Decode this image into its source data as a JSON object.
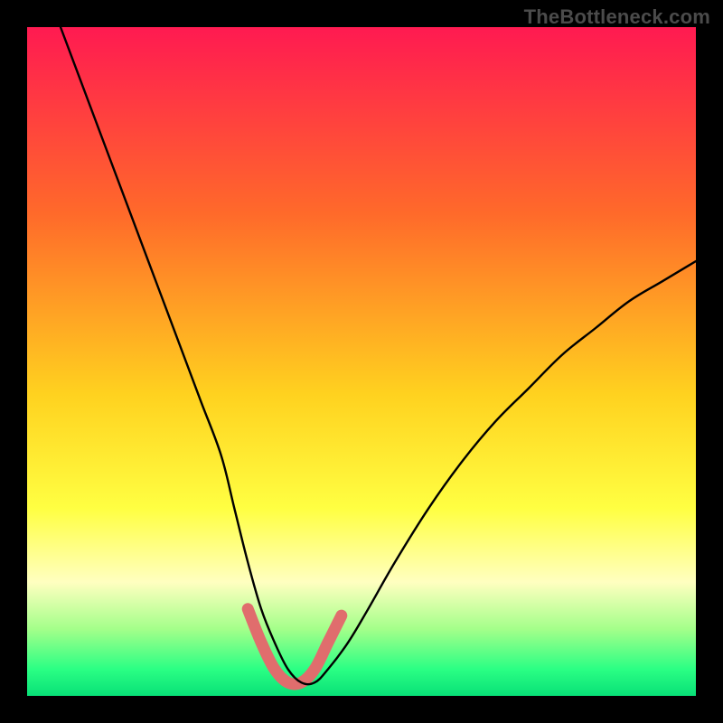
{
  "watermark": "TheBottleneck.com",
  "colors": {
    "frame": "#000000",
    "gradient_top": "#ff1a51",
    "gradient_mid1": "#ff6a2a",
    "gradient_mid2": "#ffd21f",
    "gradient_mid3": "#ffff42",
    "gradient_pale": "#ffffc0",
    "gradient_green1": "#a4ff8a",
    "gradient_green2": "#2bff84",
    "gradient_bottom": "#08e077",
    "curve": "#000000",
    "highlight": "#e06d6d"
  },
  "chart_data": {
    "type": "line",
    "title": "",
    "xlabel": "",
    "ylabel": "",
    "xlim": [
      0,
      100
    ],
    "ylim": [
      0,
      100
    ],
    "series": [
      {
        "name": "bottleneck-curve",
        "x": [
          5,
          8,
          11,
          14,
          17,
          20,
          23,
          26,
          29,
          31,
          33,
          35,
          37,
          39,
          41,
          43,
          45,
          48,
          51,
          55,
          60,
          65,
          70,
          75,
          80,
          85,
          90,
          95,
          100
        ],
        "y": [
          100,
          92,
          84,
          76,
          68,
          60,
          52,
          44,
          36,
          28,
          20,
          13,
          8,
          4,
          2,
          2,
          4,
          8,
          13,
          20,
          28,
          35,
          41,
          46,
          51,
          55,
          59,
          62,
          65
        ]
      },
      {
        "name": "optimal-band-highlight",
        "x": [
          33,
          35,
          37,
          39,
          41,
          43,
          45,
          47
        ],
        "y": [
          13,
          8,
          4,
          2,
          2,
          4,
          8,
          12
        ]
      }
    ],
    "annotations": []
  }
}
